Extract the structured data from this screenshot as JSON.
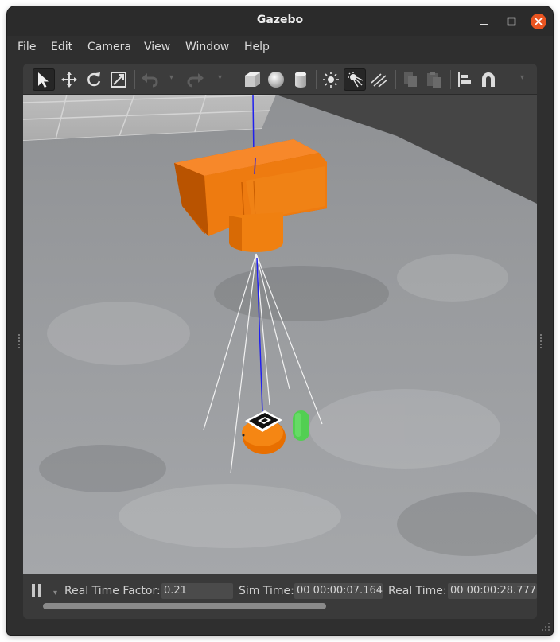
{
  "window": {
    "title": "Gazebo",
    "close_color": "#e95420"
  },
  "menu": {
    "items": [
      "File",
      "Edit",
      "Camera",
      "View",
      "Window",
      "Help"
    ]
  },
  "toolbar": {
    "tools": [
      {
        "name": "select-mode",
        "icon": "arrow-cursor-icon",
        "active": true
      },
      {
        "name": "translate-mode",
        "icon": "move-arrows-icon",
        "active": false
      },
      {
        "name": "rotate-mode",
        "icon": "rotate-icon",
        "active": false
      },
      {
        "name": "scale-mode",
        "icon": "scale-icon",
        "active": false
      },
      {
        "name": "undo",
        "icon": "undo-icon",
        "active": false
      },
      {
        "name": "redo",
        "icon": "redo-icon",
        "active": false
      },
      {
        "name": "insert-box",
        "icon": "box-icon",
        "active": false
      },
      {
        "name": "insert-sphere",
        "icon": "sphere-icon",
        "active": false
      },
      {
        "name": "insert-cylinder",
        "icon": "cylinder-icon",
        "active": false
      },
      {
        "name": "point-light",
        "icon": "point-light-icon",
        "active": false
      },
      {
        "name": "spot-light",
        "icon": "spot-light-icon",
        "active": true
      },
      {
        "name": "directional-light",
        "icon": "directional-light-icon",
        "active": false
      },
      {
        "name": "copy",
        "icon": "copy-icon",
        "active": false
      },
      {
        "name": "paste",
        "icon": "paste-icon",
        "active": false
      },
      {
        "name": "align",
        "icon": "align-icon",
        "active": false
      },
      {
        "name": "snap",
        "icon": "magnet-icon",
        "active": false
      }
    ]
  },
  "scene": {
    "camera_color": "#f0760b",
    "marker_color": "#4fcf4f",
    "axis_color": "#1a1aff"
  },
  "status": {
    "real_time_factor_label": "Real Time Factor:",
    "real_time_factor": "0.21",
    "sim_time_label": "Sim Time:",
    "sim_time": "00 00:00:07.164",
    "real_time_label": "Real Time:",
    "real_time": "00 00:00:28.777"
  }
}
